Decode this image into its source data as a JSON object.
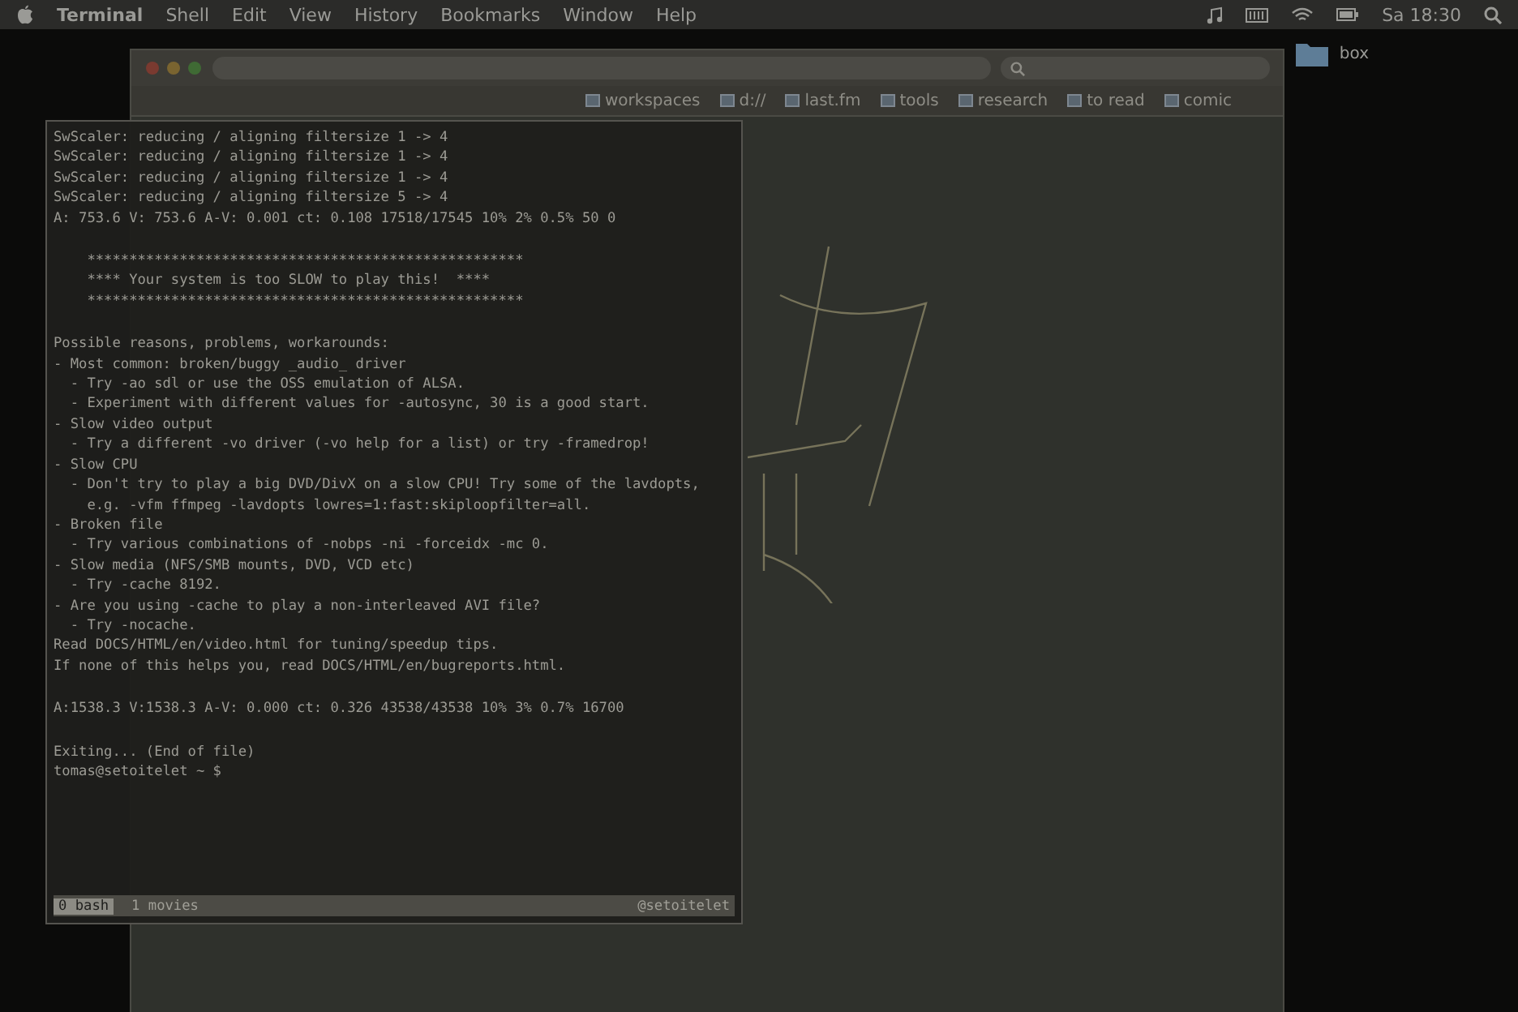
{
  "menu_bar": {
    "app": "Terminal",
    "items": [
      "Shell",
      "Edit",
      "View",
      "History",
      "Bookmarks",
      "Window",
      "Help"
    ],
    "clock": "Sa 18:30"
  },
  "desktop": {
    "folder": "box"
  },
  "browser": {
    "bookmarks": [
      "workspaces",
      "d://",
      "last.fm",
      "tools",
      "research",
      "to read",
      "comic"
    ]
  },
  "terminal": {
    "blocks": [
      [
        "SwScaler: reducing / aligning filtersize 1 -> 4",
        "SwScaler: reducing / aligning filtersize 1 -> 4",
        "SwScaler: reducing / aligning filtersize 1 -> 4",
        "SwScaler: reducing / aligning filtersize 5 -> 4",
        "A: 753.6 V: 753.6 A-V: 0.001 ct: 0.108 17518/17545 10% 2% 0.5% 50 0"
      ],
      [
        "    ****************************************************",
        "    **** Your system is too SLOW to play this!  ****",
        "    ****************************************************"
      ],
      [
        "Possible reasons, problems, workarounds:",
        "- Most common: broken/buggy _audio_ driver",
        "  - Try -ao sdl or use the OSS emulation of ALSA.",
        "  - Experiment with different values for -autosync, 30 is a good start.",
        "- Slow video output",
        "  - Try a different -vo driver (-vo help for a list) or try -framedrop!",
        "- Slow CPU",
        "  - Don't try to play a big DVD/DivX on a slow CPU! Try some of the lavdopts,",
        "    e.g. -vfm ffmpeg -lavdopts lowres=1:fast:skiploopfilter=all.",
        "- Broken file",
        "  - Try various combinations of -nobps -ni -forceidx -mc 0.",
        "- Slow media (NFS/SMB mounts, DVD, VCD etc)",
        "  - Try -cache 8192.",
        "- Are you using -cache to play a non-interleaved AVI file?",
        "  - Try -nocache.",
        "Read DOCS/HTML/en/video.html for tuning/speedup tips.",
        "If none of this helps you, read DOCS/HTML/en/bugreports.html."
      ],
      [
        "A:1538.3 V:1538.3 A-V: 0.000 ct: 0.326 43538/43538 10% 3% 0.7% 16700"
      ],
      [
        "Exiting... (End of file)",
        "tomas@setoitelet ~ $"
      ]
    ],
    "status": {
      "windows": [
        {
          "label": "0 bash",
          "selected": true
        },
        {
          "label": "1 movies",
          "selected": false
        }
      ],
      "host": "@setoitelet"
    }
  }
}
